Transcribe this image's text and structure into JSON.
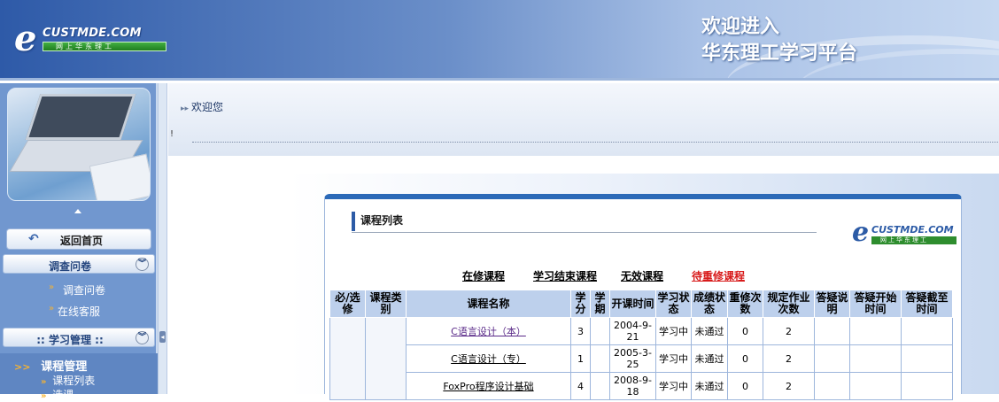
{
  "header": {
    "logo_mark": "e",
    "logo_name": "CUSTMDE.COM",
    "logo_tag": "网上华东理工",
    "welcome_line1": "欢迎进入",
    "welcome_line2": "华东理工学习平台"
  },
  "sidebar": {
    "home_label": "返回首页",
    "survey_section": {
      "title": "调查问卷",
      "items": [
        "调查问卷",
        "在线客服"
      ]
    },
    "study_section": {
      "title": "::   学习管理   ::"
    },
    "tree": {
      "node": "课程管理",
      "children": [
        "课程列表",
        "选课"
      ]
    }
  },
  "main": {
    "breadcrumb": "欢迎您",
    "mark": "!"
  },
  "panel": {
    "title": "课程列表",
    "logo_mark": "e",
    "logo_name": "CUSTMDE.COM",
    "logo_tag": "网上华东理工",
    "tabs": [
      {
        "label": "在修课程",
        "active": false
      },
      {
        "label": "学习结束课程",
        "active": false
      },
      {
        "label": "无效课程",
        "active": false
      },
      {
        "label": "待重修课程",
        "active": true
      }
    ],
    "columns": [
      "必/选修",
      "课程类别",
      "课程名称",
      "学分",
      "学期",
      "开课时间",
      "学习状态",
      "成绩状态",
      "重修次数",
      "规定作业次数",
      "答疑说明",
      "答疑开始时间",
      "答疑截至时间"
    ],
    "rows": [
      {
        "name": "C语言设计（本）",
        "credit": "3",
        "term": "",
        "start": "2004-9-21",
        "study_status": "学习中",
        "grade_status": "未通过",
        "retake": "0",
        "homework": "2"
      },
      {
        "name": "C语言设计（专）",
        "credit": "1",
        "term": "",
        "start": "2005-3-25",
        "study_status": "学习中",
        "grade_status": "未通过",
        "retake": "0",
        "homework": "2"
      },
      {
        "name": "FoxPro程序设计基础",
        "credit": "4",
        "term": "",
        "start": "2008-9-18",
        "study_status": "学习中",
        "grade_status": "未通过",
        "retake": "0",
        "homework": "2"
      }
    ]
  },
  "colors": {
    "header_blue": "#2e5aa8",
    "sidebar_blue": "#7197cf",
    "table_header": "#bdd0ec",
    "active_tab": "#d81b1b"
  }
}
